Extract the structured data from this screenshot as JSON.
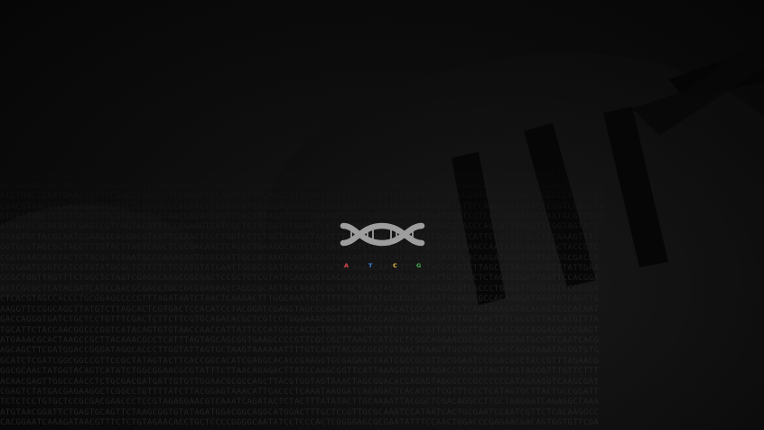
{
  "screen": {
    "background_color": "#080808",
    "sequence_text_color": "#242424"
  },
  "logo": {
    "icon": "dna-helix-icon",
    "color": "#9e9e9e"
  },
  "bases": [
    {
      "letter": "A",
      "color": "#e0484d"
    },
    {
      "letter": "T",
      "color": "#3f80d8"
    },
    {
      "letter": "C",
      "color": "#e8c24a"
    },
    {
      "letter": "G",
      "color": "#4aad57"
    }
  ],
  "sequence_background": {
    "lines": [
      "CCTAATACGGTCAGGACCTCGCATCATCGATGTTAATGCGTTAATCCGAGGTCATGACGCTTGAGCCATAACGCGATCTCGCCTAACATCGGTAACTTGAAGTCCATAACGCT",
      "TTACACGATGACCGTGTCTGAGACACTGAGAGTTCCAGACATGTCGGTCGTATCGACTTTGCCGAATAGGATGATGCATGCGGCAGTGAGGTACTCGATCATTTCCTGGACTCC",
      "GTTAACGCGACCAACCACGTACAGACTTTAAACAGTCTGTTAGACGTGCAGACGTTGCAAGTTCTAGCGTGCCTGATTTATCGAGCCCGATCAACGCCTTATTACAGTTCTAGCT",
      "ATCTGACCCGATGAATCATTTCGAGCCGACTGTTCAGACTCCAAATGTGTCAGCCCTGCAATACGTATCCGCATTAGTGATCCATGAGCGATACCTTGTACCTCGCCCAGTTCTG",
      "CAACGTAACGTCGAGTGATTGGATCTCGGGGCCCAGTACTCGTAGCATGATGGACGAAACCAGCAGATCTGCAATGAGTTAAAGGCTATTCCAAACGATGTACTCGGTCCAGCTA",
      "GTCAATAGCCCCTTTACCTTTCGTACGCTGATAACGACACGAGTTCACATTAGATCGTCAGAGGCTCCGCGAAGGAAGCCTGGATCGGTCGTCACAGCGATCCTAATACGTCGAC",
      "ATCGTCCACATAATCGAGTCGTCAGTACATTACCGGAGGTCATCGCTCTACGGTTCGGACTCCTAGCGGATACATGTCAACCAGACGTACCCAGCATTTACGTTCGGTAGTACC",
      "TAAGTGCTACGCAATCGAAGACACGACGTAATTCGAACTCCCTGGTCCTCTGCTGAAGCTACCCTTATCAAAACCTCCGCATCGCGGCCCATTCCGCTCCGCCTTCAAAGTTTG",
      "GGTGCGTAGCGCTAGGTTTGTACTTAGTCAGCTCGCGACAACTCACGCTGAAGGCAGTCGTCGAACAGTCCGAAGGCCGATGGTAAAGAAACCAATTATCGAGCCGCTACCCTC",
      "CCGTGAACATCTACTCTACGCTCAAATGCCCAAAGAGTACGCGATTGCCATAAGTCGATGCGGTGAAAGTTTTCCACGCTCCTAATATCACAAGATAGGTGGTTGTGGCGACCT",
      "TCCGAATCGGTCATCGTGTATGCGCTCTTCTCTCCATGTATGAATTGCGCCGATGCAGCATCGCTACAAACCAATCTTCTGTACCCATTCTTAGCCTTACCCACGTTTATTGAA",
      "GCGCTGGTTAGTTTCTGGCTCTAGTCGAGACAAGCCGCGACTCCGCTCTCGTATTGACCGGTGACGAGAAAGTGGTGGCAGGATTGTTACCTCTAGACGGATTAGTTCCACGGA",
      "ACTCGCGCTCATACGATCATCCAACGCGACCTGCCGCCGAGAACCAGGCGCAGTACCAGATCGCTTGCTAGGTACCCTTCGGTAGACGTCACCCTGGAGTTGCGAGTCCCCGGA",
      "CTCACGTAGCCACCCTGCGGAGCCCCCTTTAGATAATCTAACTCAAAACTTTGGCAAATGCTTTTTGGTTTATGCCCGCATGAATTAAGGCGCCACAAGGATAAGTATCAGTTG",
      "AAGGTTCCGGCAGCTTATGTCTTAGCACTCGTGACTCCACATCCTACGGATCGAGGTAGCCCAGATGTGTTATAACATCGCACCGTTCTCAGTAAAGGTACACAGTCGCACAAT",
      "GACCAGGGTGATCTGCTCCTGTTTCGACTCTTCTTCGTGCAGACACGCTCGTCCTGGGAAACGGTTATTACCCAGCTGAAGAAGATTTGGTAACTTTCGCCCTTATCATGTTTA",
      "TGCATTCTACCAACGGCCCGGTCATACAGTGTGTAACCAACCATTATTCCCATGGCCACGCTGGTATAACTGCTTCTTACCGTTATCGGTTACACTACGCCAGGACGTCCGAGT",
      "ATGAAACGCACTAAGCCGCTTACAAACGCCTCATTTAGTAGCAGCGGTGAAGCCCCGTTCGCCGCTTAAGTCATCGCTCGGCAGGAACGCGAGCCCGGAATGCCTTCAATCACG",
      "AGCAGCTTCGATGGACCGGGATAGGCACCCTTGGTATTAGTGCTAAGTAAAAAATTTTGTCAGTTACGGCGCGTGTAACTTAAGTTGCGTAGGCGACCAGGTAAATAGGGTGTG",
      "GCATCTCGATCGGCGGCCGTTCCGCTATAGTACTTCACCGGCACATCGAGGCACACCGAAGGTGCGAGAACTAATCGCCGCGTTGCGGAATCCGGACGCCTACCGTTTAGAACG",
      "GGCGCAACTATGGTACAGTCATATCTGGCGGAACGCGTATTTCTTAACAGAGACTTATCCAAGCGGTTCATTAAAGGTGTATAGACCTCCGATAGTTAGTAGGGTTTGTTCTTT",
      "ACAACGAGTTGGCCAACCTCTGCGACGATGATTGTGTTGGAACGCGCCAGCTTACGTGGTAGTAAACTAGCGGACACCAGAGTAGGGCCCGCCCCCCATAGAAGGTCAAGCGAT",
      "CGAGTCTATGACGAGAAGGCTCGGCCTGTTTTATCTTACGGAGTAAACATTGACCCTCAAATAAGGATCAGAGACTCACATCGTCGTTTCGCTCATAGTGCTTACTGCCGGATT",
      "TCTCTCCTGTGCTCCGCGACGAACCCTCCGTAGAGGAACGTCAAATCAGATACTCTACTTTATATACTTGCAAAATTACGGCTCGACAGGCCTTGCTGAGGATCAGAGGCTAAA",
      "ATGTAACGGATTCTGAGTGCAGTTCTAAGCGGTGTATAGATGGACGGCAGGCATGGACTTTGCTCCGTTGCGCAAATCCATAATCACTGCGAATCCAATCGTTCTCACAAGGCC",
      "CACGGAATCAAAGATAACGTTTCTCTGTAGAACACCTGCTCCCCGGGGCAATATCCTCCCACTCGGGGAGCGCGAATATTTCCAACTGGACCCGAGAACGACAGTGGTGTTCGA"
    ]
  }
}
